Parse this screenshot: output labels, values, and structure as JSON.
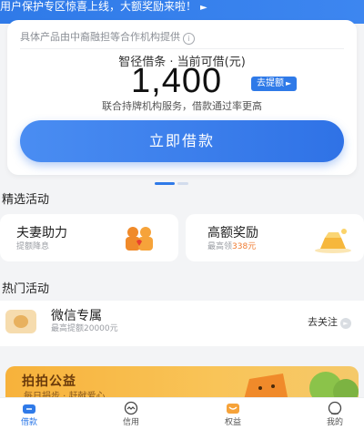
{
  "banner": {
    "text": "用户保护专区惊喜上线，大额奖励来啦！",
    "arrow": "►"
  },
  "card": {
    "provider": "具体产品由中裔融担等合作机构提供",
    "info_icon": "i",
    "limit_label": "智径借条 · 当前可借(元)",
    "amount": "1,400",
    "raise_label": "去提额",
    "raise_arrow": "►",
    "service_text": "联合持牌机构服务，借款通过率更高",
    "borrow_label": "立即借款"
  },
  "sections": {
    "featured": "精选活动",
    "hot": "热门活动"
  },
  "activities": [
    {
      "title": "夫妻助力",
      "subtitle": "提额降息"
    },
    {
      "title": "高额奖励",
      "subtitle_prefix": "最高领",
      "subtitle_highlight": "338元"
    }
  ],
  "hot_item": {
    "title": "微信专属",
    "subtitle": "最高提额20000元",
    "action": "去关注",
    "action_arrow": "►"
  },
  "promo": {
    "title": "拍拍公益",
    "subtitle": "每日捐步 · 赶献爱心"
  },
  "tabs": [
    {
      "label": "借款",
      "icon": "home-icon",
      "active": true
    },
    {
      "label": "信用",
      "icon": "credit-icon",
      "active": false
    },
    {
      "label": "权益",
      "icon": "gift-icon",
      "active": false
    },
    {
      "label": "我的",
      "icon": "profile-icon",
      "active": false
    }
  ],
  "colors": {
    "accent": "#2f7ae8",
    "highlight": "#ef7a2f",
    "promo": "#f7b23b"
  }
}
